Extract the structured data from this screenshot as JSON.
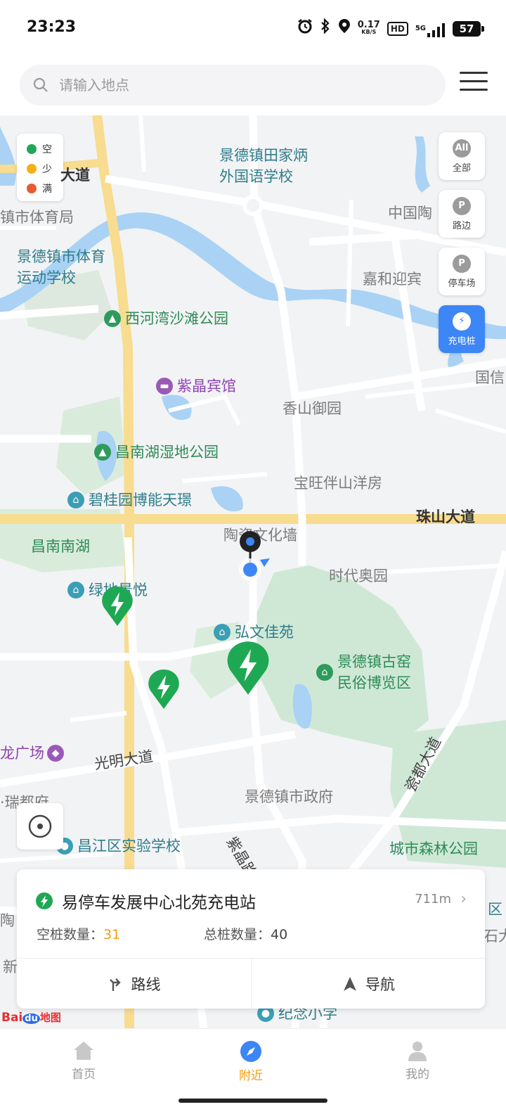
{
  "status_bar": {
    "time": "23:23",
    "net_speed_value": "0.17",
    "net_speed_unit": "KB/S",
    "hd_label": "HD",
    "signal_label": "5G",
    "battery": "57",
    "icons": [
      "alarm-icon",
      "bluetooth-icon",
      "location-icon",
      "wifi-icon",
      "signal-icon"
    ]
  },
  "search": {
    "placeholder": "请输入地点",
    "icon": "search-icon",
    "menu_icon": "menu-icon"
  },
  "map": {
    "legend": [
      {
        "label": "空",
        "color": "#1fa853"
      },
      {
        "label": "少",
        "color": "#f5b014"
      },
      {
        "label": "满",
        "color": "#ea5a32"
      }
    ],
    "filters": [
      {
        "icon_text": "All",
        "label": "全部"
      },
      {
        "icon_text": "P",
        "label": "路边"
      },
      {
        "icon_text": "P",
        "label": "停车场"
      },
      {
        "icon_text": "⚡",
        "label": "充电桩",
        "active": true
      }
    ],
    "labels": {
      "jdz_tianjiabing_line1": "景德镇田家炳",
      "jdz_tianjiabing_line2": "外国语学校",
      "dadao_fragment": "大道",
      "sports_bureau": "镇市体育局",
      "sports_school_line1": "景德镇市体育",
      "sports_school_line2": "运动学校",
      "china_tao": "中国陶",
      "jiahe_hotel": "嘉和迎宾",
      "xihewan_park": "西河湾沙滩公园",
      "zijing_hotel": "紫晶宾馆",
      "guo_fragment": "国信",
      "xiangshan_yuyuan": "香山御园",
      "changnanhu_wetland": "昌南湖湿地公园",
      "baowang": "宝旺伴山洋房",
      "biguiyuan": "碧桂园博能天璟",
      "zhushan_dadao": "珠山大道",
      "changnan_nanhu": "昌南南湖",
      "taoci_wall": "陶瓷文化墙",
      "shidai_aoyuan": "时代奥园",
      "lvdi_jingyue": "绿地景悦",
      "hongwen_jiayuan": "弘文佳苑",
      "folk_museum_line1": "景德镇古窑",
      "folk_museum_line2": "民俗博览区",
      "long_plaza": "龙广场",
      "guangming_dadao": "光明大道",
      "cidu_dadao": "瓷都大道",
      "dubu_fragment": "·瑞都府",
      "city_gov": "景德镇市政府",
      "changjiang_school": "昌江区实验学校",
      "ziqi_fragment": "紫晶路",
      "forest_park": "城市森林公园",
      "memorial_school": "纪念小学",
      "tao_fragment": "陶",
      "xin_fragment": "新",
      "qu_fragment": "区",
      "you_fragment": "石大"
    }
  },
  "station_card": {
    "name": "易停车发展中心北苑充电站",
    "distance": "711m",
    "free_label": "空桩数量：",
    "free_value": "31",
    "total_label": "总桩数量：",
    "total_value": "40",
    "route_label": "路线",
    "navigate_label": "导航"
  },
  "logo": {
    "bai": "Bai",
    "du": "du",
    "ditu": "地图"
  },
  "bottom_nav": [
    {
      "label": "首页",
      "icon": "home-icon"
    },
    {
      "label": "附近",
      "icon": "compass-icon",
      "active": true
    },
    {
      "label": "我的",
      "icon": "profile-icon"
    }
  ],
  "colors": {
    "accent": "#3d86f5",
    "charger_green": "#1fa853",
    "nav_active": "#f39c12"
  }
}
